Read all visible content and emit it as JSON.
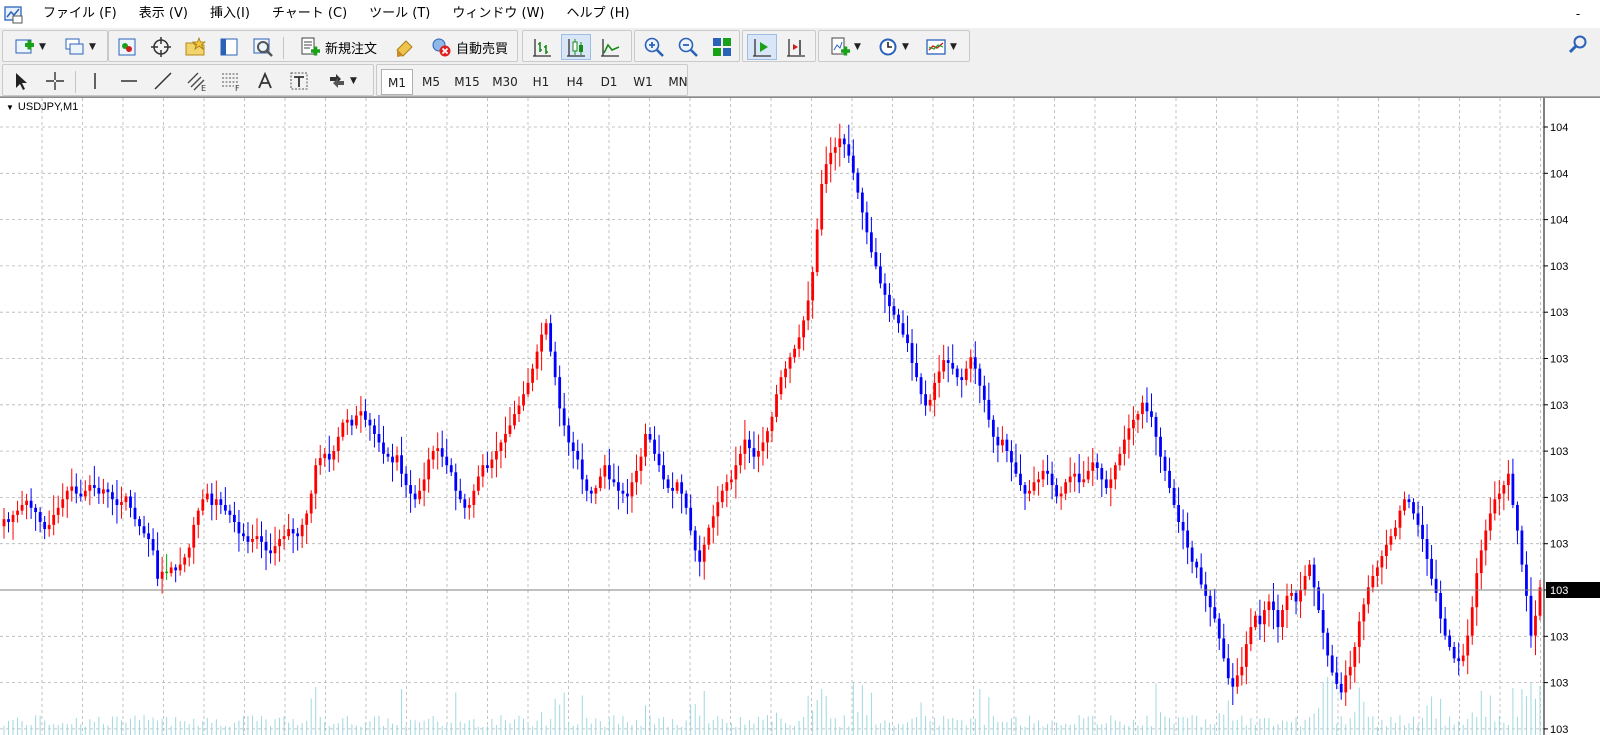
{
  "menu": {
    "items": [
      "ファイル (F)",
      "表示 (V)",
      "挿入(I)",
      "チャート (C)",
      "ツール (T)",
      "ウィンドウ (W)",
      "ヘルプ (H)"
    ],
    "minimize_label": "-"
  },
  "toolbar": {
    "new_order_label": "新規注文",
    "auto_trading_label": "自動売買"
  },
  "timeframes": [
    "M1",
    "M5",
    "M15",
    "M30",
    "H1",
    "H4",
    "D1",
    "W1",
    "MN"
  ],
  "active_timeframe": "M1",
  "chart": {
    "symbol_label": "USDJPY,M1",
    "price_axis_labels": [
      "104",
      "104",
      "104",
      "103",
      "103",
      "103",
      "103",
      "103",
      "103",
      "103",
      "103",
      "103",
      "103",
      "103"
    ],
    "current_price_label": "103",
    "colors": {
      "bull": "#ff0000",
      "bear": "#0000ff",
      "doji": "#00aa00",
      "grid": "#b4b4b4",
      "volume": "#9fd8e0",
      "price_line": "#808080"
    }
  },
  "chart_data": {
    "type": "candlestick",
    "symbol": "USDJPY",
    "timeframe": "M1",
    "close_series": [
      0.52,
      0.5,
      0.55,
      0.58,
      0.62,
      0.65,
      0.6,
      0.57,
      0.5,
      0.45,
      0.48,
      0.55,
      0.6,
      0.66,
      0.72,
      0.75,
      0.7,
      0.68,
      0.72,
      0.76,
      0.74,
      0.7,
      0.73,
      0.71,
      0.66,
      0.62,
      0.64,
      0.68,
      0.6,
      0.52,
      0.47,
      0.42,
      0.38,
      0.3,
      0.1,
      0.15,
      0.14,
      0.18,
      0.16,
      0.2,
      0.25,
      0.32,
      0.48,
      0.58,
      0.66,
      0.7,
      0.62,
      0.66,
      0.62,
      0.58,
      0.55,
      0.5,
      0.42,
      0.4,
      0.36,
      0.38,
      0.4,
      0.36,
      0.3,
      0.28,
      0.33,
      0.38,
      0.4,
      0.45,
      0.42,
      0.4,
      0.48,
      0.56,
      0.7,
      0.9,
      0.95,
      0.98,
      0.94,
      1.0,
      1.1,
      1.2,
      1.22,
      1.18,
      1.25,
      1.28,
      1.22,
      1.18,
      1.12,
      1.06,
      0.98,
      0.96,
      0.92,
      0.97,
      0.84,
      0.76,
      0.7,
      0.66,
      0.72,
      0.8,
      0.94,
      1.0,
      1.02,
      0.96,
      0.9,
      0.85,
      0.72,
      0.66,
      0.6,
      0.62,
      0.72,
      0.82,
      0.9,
      0.88,
      0.94,
      1.0,
      1.06,
      1.12,
      1.18,
      1.26,
      1.32,
      1.4,
      1.48,
      1.58,
      1.7,
      1.82,
      1.9,
      1.7,
      1.52,
      1.3,
      1.18,
      1.06,
      1.0,
      0.94,
      0.8,
      0.72,
      0.7,
      0.74,
      0.82,
      0.9,
      0.8,
      0.78,
      0.72,
      0.7,
      0.68,
      0.78,
      0.86,
      0.96,
      1.12,
      1.08,
      0.98,
      0.9,
      0.8,
      0.74,
      0.72,
      0.78,
      0.7,
      0.6,
      0.44,
      0.3,
      0.22,
      0.34,
      0.46,
      0.54,
      0.64,
      0.72,
      0.78,
      0.8,
      0.9,
      0.98,
      1.08,
      1.02,
      0.96,
      1.0,
      1.06,
      1.14,
      1.24,
      1.4,
      1.52,
      1.58,
      1.66,
      1.72,
      1.8,
      1.92,
      2.06,
      2.26,
      2.56,
      2.88,
      3.02,
      3.1,
      3.14,
      3.2,
      3.16,
      3.08,
      2.96,
      2.82,
      2.68,
      2.54,
      2.4,
      2.3,
      2.18,
      2.1,
      2.02,
      1.96,
      1.9,
      1.82,
      1.76,
      1.62,
      1.52,
      1.4,
      1.32,
      1.36,
      1.48,
      1.56,
      1.64,
      1.62,
      1.58,
      1.52,
      1.5,
      1.58,
      1.66,
      1.58,
      1.46,
      1.36,
      1.22,
      1.1,
      1.04,
      1.08,
      1.0,
      0.92,
      0.84,
      0.76,
      0.7,
      0.72,
      0.78,
      0.8,
      0.86,
      0.84,
      0.76,
      0.68,
      0.7,
      0.78,
      0.82,
      0.84,
      0.78,
      0.8,
      0.86,
      0.92,
      0.88,
      0.8,
      0.74,
      0.8,
      0.9,
      0.98,
      1.08,
      1.16,
      1.22,
      1.26,
      1.34,
      1.28,
      1.24,
      1.1,
      0.96,
      0.86,
      0.74,
      0.62,
      0.5,
      0.44,
      0.32,
      0.22,
      0.18,
      0.06,
      -0.02,
      -0.1,
      -0.18,
      -0.32,
      -0.46,
      -0.6,
      -0.66,
      -0.58,
      -0.52,
      -0.36,
      -0.24,
      -0.16,
      -0.22,
      -0.12,
      -0.06,
      -0.12,
      -0.24,
      -0.12,
      -0.02,
      0.0,
      -0.06,
      0.02,
      0.12,
      0.2,
      0.04,
      -0.12,
      -0.28,
      -0.44,
      -0.56,
      -0.64,
      -0.7,
      -0.58,
      -0.52,
      -0.38,
      -0.2,
      -0.08,
      0.04,
      0.12,
      0.18,
      0.26,
      0.34,
      0.4,
      0.46,
      0.58,
      0.66,
      0.64,
      0.56,
      0.48,
      0.38,
      0.24,
      0.1,
      0.0,
      -0.18,
      -0.3,
      -0.38,
      -0.46,
      -0.48,
      -0.44,
      -0.3,
      -0.1,
      0.14,
      0.3,
      0.44,
      0.56,
      0.66,
      0.7,
      0.76,
      0.84,
      0.62,
      0.44,
      0.2,
      -0.02,
      -0.3,
      -0.16,
      0.04
    ]
  }
}
